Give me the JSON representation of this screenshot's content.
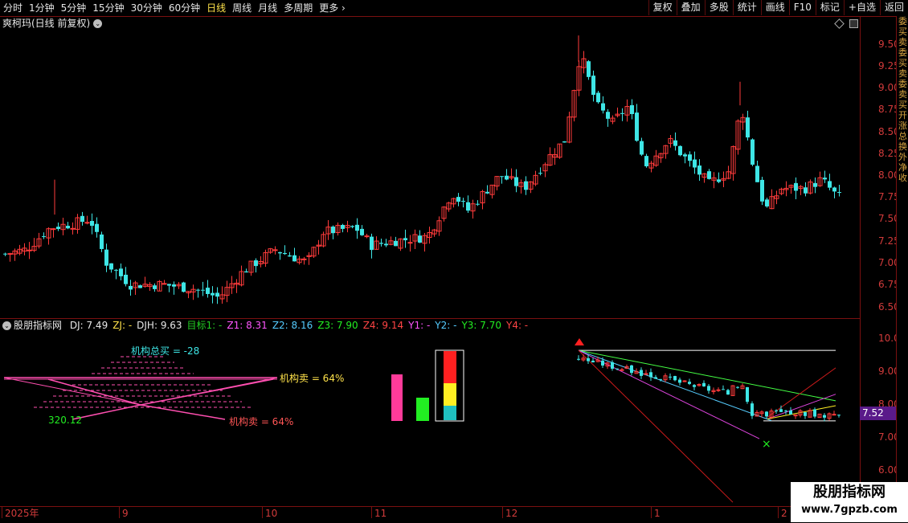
{
  "toolbar": {
    "periods": [
      "分时",
      "1分钟",
      "5分钟",
      "15分钟",
      "30分钟",
      "60分钟",
      "日线",
      "周线",
      "月线",
      "多周期",
      "更多"
    ],
    "active": "日线",
    "more_glyph": "›",
    "buttons": [
      "复权",
      "叠加",
      "多股",
      "统计",
      "画线",
      "F10",
      "标记",
      "+自选",
      "返回"
    ]
  },
  "stock": {
    "title": "爽柯玛(日线 前复权)",
    "menu_glyph": "⌄"
  },
  "price_axis": {
    "labels": [
      "9.50",
      "9.25",
      "9.00",
      "8.75",
      "8.50",
      "8.25",
      "8.00",
      "7.75",
      "7.50",
      "7.25",
      "7.00",
      "6.75",
      "6.50"
    ]
  },
  "indicator": {
    "name": "股朋指标网",
    "fields": [
      {
        "text": "DJ: 7.49",
        "color": "#e8e8e8"
      },
      {
        "text": "ZJ: -",
        "color": "#ffe24a"
      },
      {
        "text": "DJH: 9.63",
        "color": "#e8e8e8"
      },
      {
        "text": "目标1: -",
        "color": "#22cc22"
      },
      {
        "text": "Z1: 8.31",
        "color": "#ff55ff"
      },
      {
        "text": "Z2: 8.16",
        "color": "#55ccff"
      },
      {
        "text": "Z3: 7.90",
        "color": "#22ee22"
      },
      {
        "text": "Z4: 9.14",
        "color": "#ff4444"
      },
      {
        "text": "Y1: -",
        "color": "#ff55ff"
      },
      {
        "text": "Y2: -",
        "color": "#55ccff"
      },
      {
        "text": "Y3: 7.70",
        "color": "#22ee22"
      },
      {
        "text": "Y4: -",
        "color": "#ff4444"
      }
    ],
    "axis_labels": [
      "10.00",
      "9.00",
      "8.00",
      "7.00",
      "6.00"
    ],
    "current_price": "7.52",
    "annotations": {
      "total_buy": "机构总买 = -28",
      "sell_right": "机构卖 = 64%",
      "sell_bottom": "机构卖 = 64%",
      "left_value": "320.12"
    }
  },
  "dates": [
    "2025年",
    "9",
    "10",
    "11",
    "12",
    "1",
    "2"
  ],
  "edge_strip": [
    "委",
    "买",
    "卖",
    "委",
    "买",
    "卖",
    "委",
    "卖",
    "买",
    "开",
    "涨",
    "总",
    "换",
    "外",
    "净",
    "收"
  ],
  "watermark": {
    "title": "股朋指标网",
    "url": "www.7gpzb.com"
  },
  "colors": {
    "up": "#ff3b3b",
    "down": "#3ee6e6",
    "axis": "#d23b3b",
    "border": "#7a1010"
  }
}
